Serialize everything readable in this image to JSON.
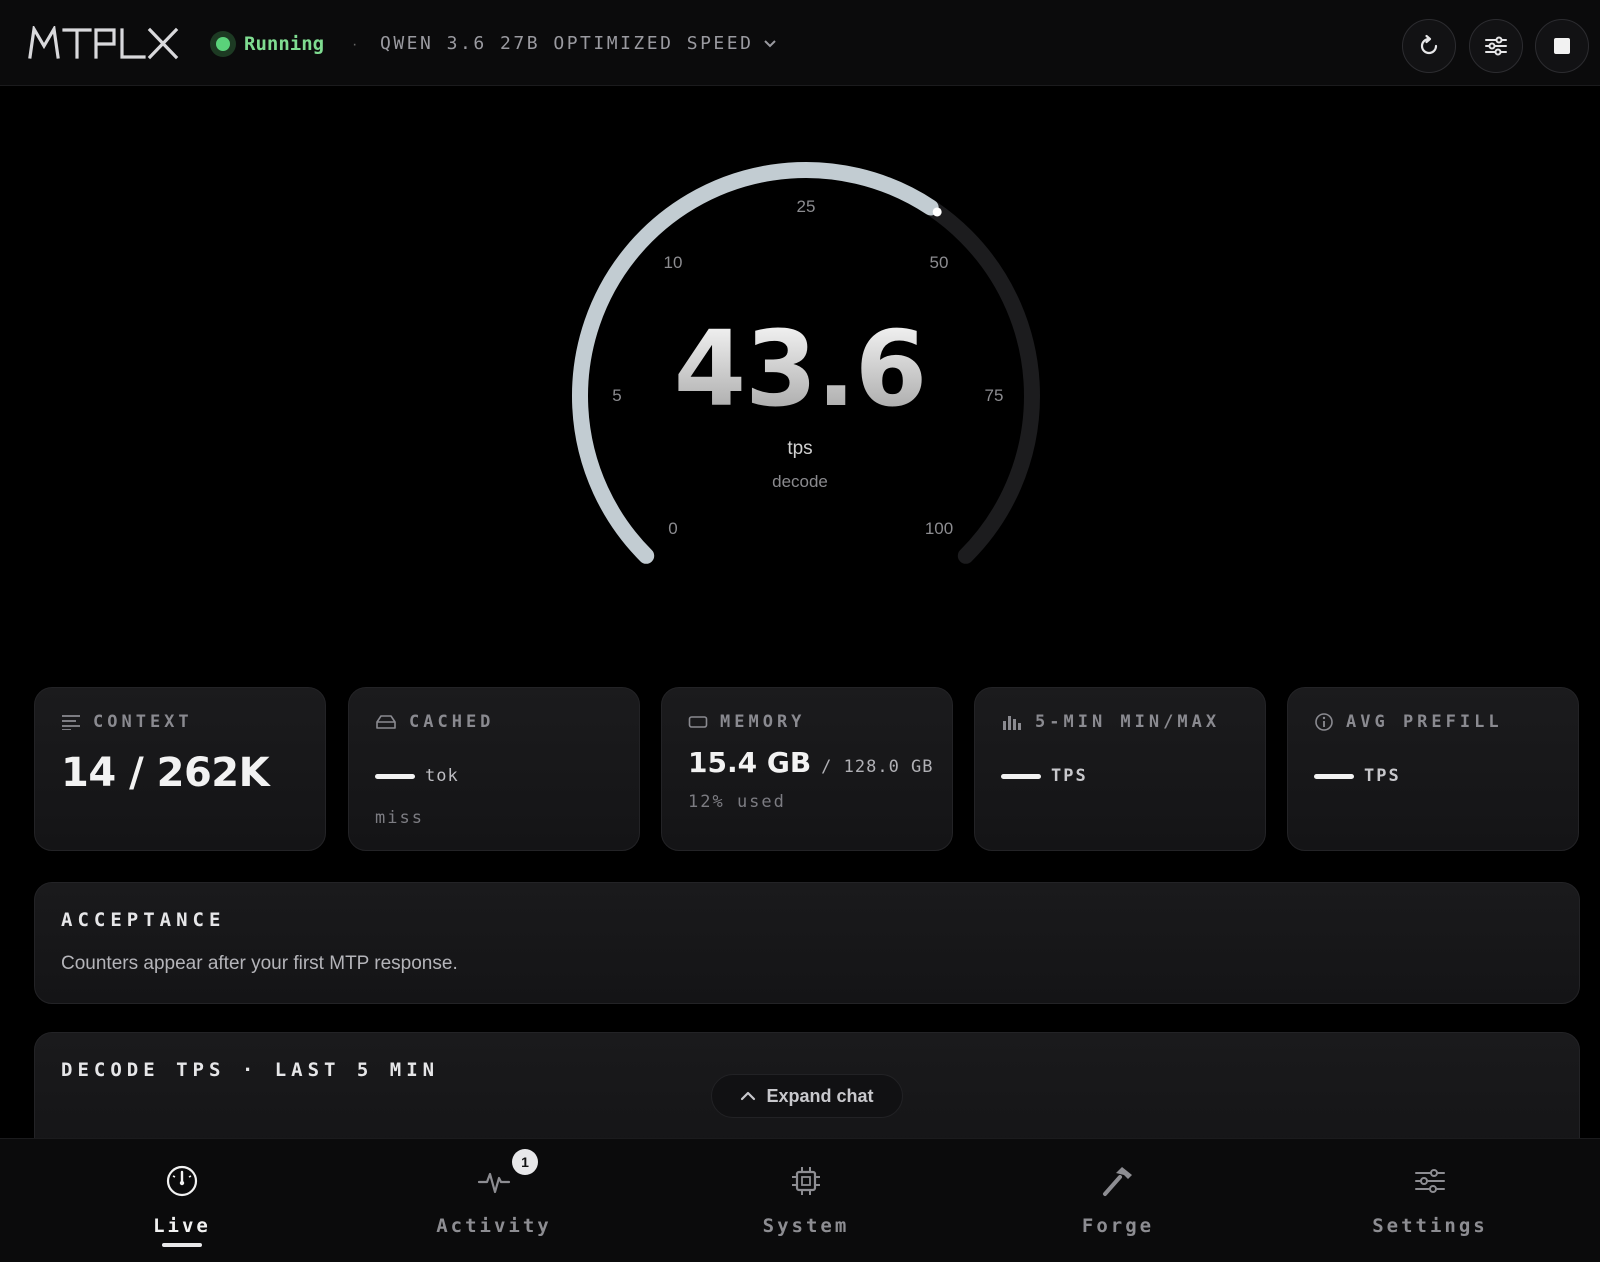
{
  "header": {
    "logo_text": "MTPLX",
    "status_label": "Running",
    "separator": "·",
    "model_label": "QWEN 3.6 27B OPTIMIZED SPEED",
    "buttons": [
      {
        "icon": "refresh-icon"
      },
      {
        "icon": "sliders-icon"
      },
      {
        "icon": "stop-icon"
      }
    ]
  },
  "gauge": {
    "value": "43.6",
    "unit": "tps",
    "sublabel": "decode",
    "max": 100,
    "reading": 43.6,
    "ticks": [
      "0",
      "5",
      "10",
      "25",
      "50",
      "75",
      "100"
    ]
  },
  "stats": {
    "context": {
      "title": "CONTEXT",
      "value": "14 / 262K"
    },
    "cached": {
      "title": "CACHED",
      "unit": "tok",
      "sub": "miss"
    },
    "memory": {
      "title": "MEMORY",
      "used": "15.4 GB",
      "total": "/ 128.0 GB",
      "sub": "12% used"
    },
    "minmax": {
      "title": "5-MIN MIN/MAX",
      "unit": "TPS"
    },
    "prefill": {
      "title": "AVG PREFILL",
      "unit": "TPS"
    }
  },
  "acceptance": {
    "title": "ACCEPTANCE",
    "message": "Counters appear after your first MTP response."
  },
  "decode_panel": {
    "title": "DECODE TPS · LAST 5 MIN"
  },
  "expand_chat": {
    "label": "Expand chat"
  },
  "nav": {
    "items": [
      {
        "label": "Live",
        "icon": "gauge-icon",
        "active": true
      },
      {
        "label": "Activity",
        "icon": "activity-icon",
        "badge": "1"
      },
      {
        "label": "System",
        "icon": "chip-icon"
      },
      {
        "label": "Forge",
        "icon": "hammer-icon"
      },
      {
        "label": "Settings",
        "icon": "sliders-icon"
      }
    ]
  },
  "colors": {
    "accent_status": "#5ad27a",
    "gauge_fill": "#c2ccd2",
    "gauge_track": "#1c1c1e"
  }
}
